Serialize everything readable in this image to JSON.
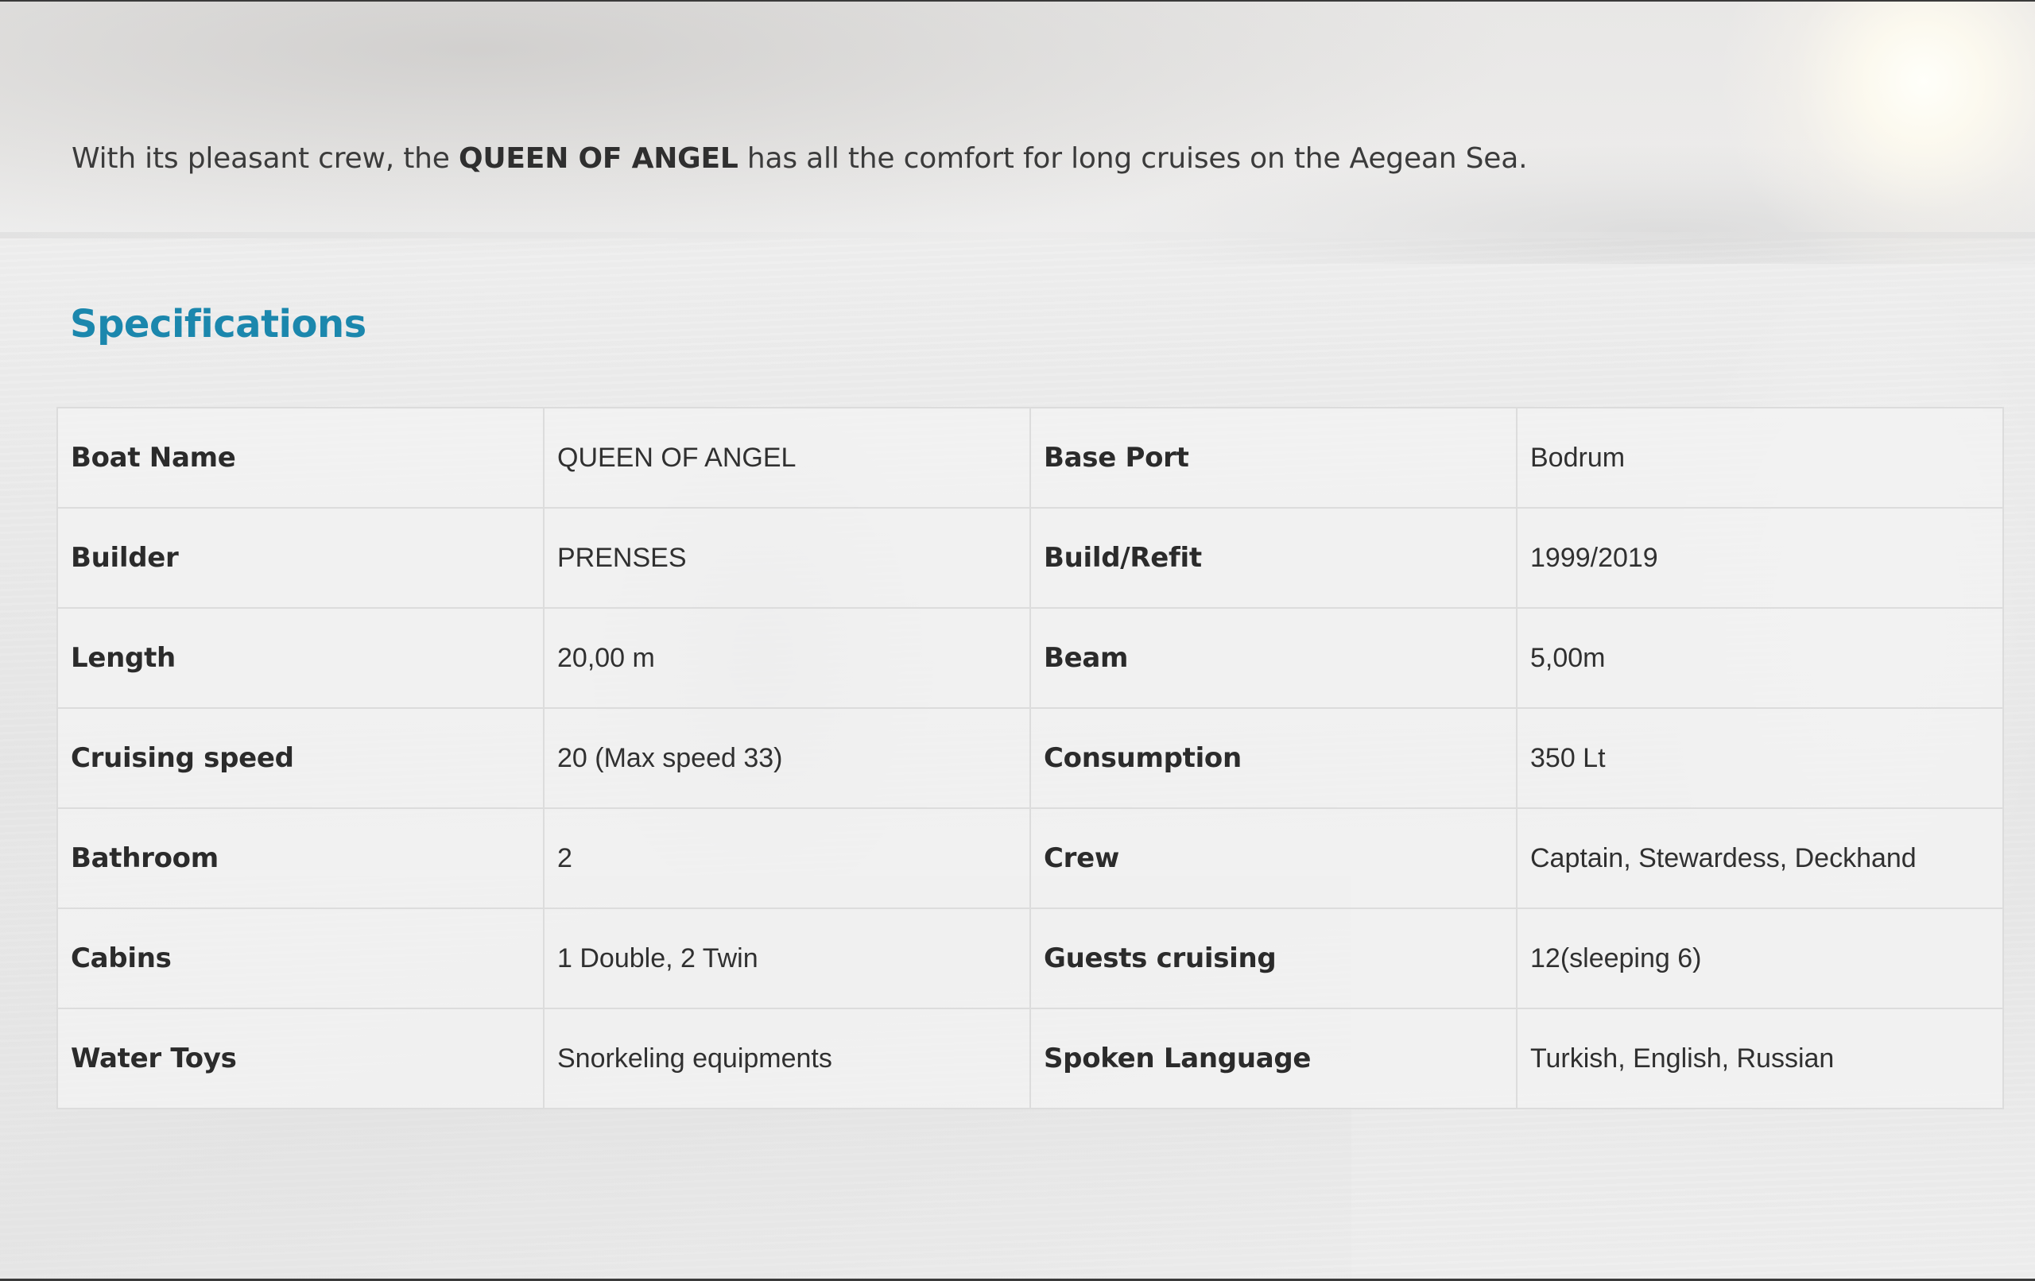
{
  "intro": {
    "before": "With its pleasant crew, the ",
    "boat_name": "QUEEN OF ANGEL",
    "after": " has all the comfort for long cruises on the Aegean Sea."
  },
  "specs_title": "Specifications",
  "specs": [
    {
      "l1": "Boat Name",
      "v1": "QUEEN OF ANGEL",
      "l2": "Base Port",
      "v2": "Bodrum"
    },
    {
      "l1": "Builder",
      "v1": "PRENSES",
      "l2": "Build/Refit",
      "v2": "1999/2019"
    },
    {
      "l1": "Length",
      "v1": "20,00 m",
      "l2": "Beam",
      "v2": "5,00m"
    },
    {
      "l1": "Cruising speed",
      "v1": "20 (Max speed 33)",
      "l2": "Consumption",
      "v2": "350 Lt"
    },
    {
      "l1": "Bathroom",
      "v1": "2",
      "l2": "Crew",
      "v2": "Captain, Stewardess, Deckhand"
    },
    {
      "l1": "Cabins",
      "v1": "1 Double, 2 Twin",
      "l2": "Guests cruising",
      "v2": "12(sleeping 6)"
    },
    {
      "l1": "Water Toys",
      "v1": "Snorkeling equipments",
      "l2": "Spoken Language",
      "v2": "Turkish, English, Russian"
    }
  ],
  "theme": {
    "accent": "#1b87ad",
    "text": "#2d2d2d",
    "cell_bg": "#f2f2f2",
    "cell_border": "#dcdcdc"
  }
}
